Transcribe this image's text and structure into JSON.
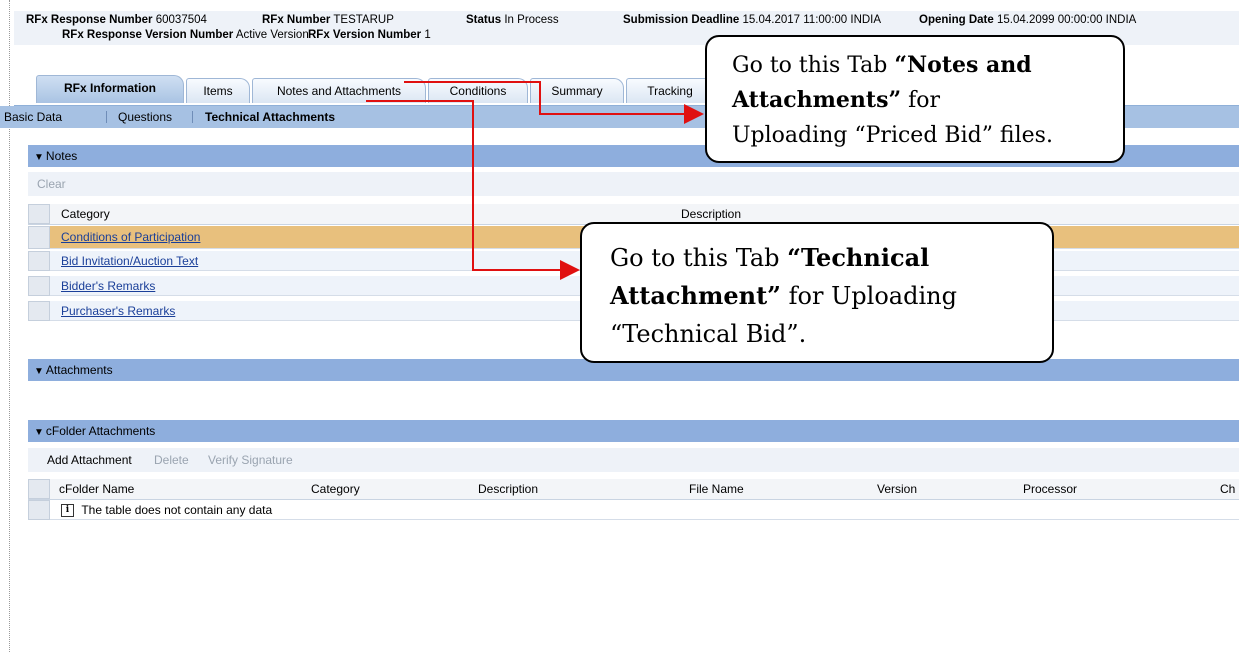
{
  "header": {
    "rfx_response_number_label": "RFx Response Number",
    "rfx_response_number": "60037504",
    "rfx_number_label": "RFx Number",
    "rfx_number": "TESTARUP",
    "status_label": "Status",
    "status": "In Process",
    "submission_deadline_label": "Submission Deadline",
    "submission_deadline": "15.04.2017 11:00:00 INDIA",
    "opening_date_label": "Opening Date",
    "opening_date": "15.04.2099 00:00:00 INDIA",
    "response_version_number_label": "RFx Response Version Number",
    "response_version_number": "Active Version",
    "rfx_version_number_label": "RFx Version Number",
    "rfx_version_number": "1"
  },
  "tabs": [
    "RFx Information",
    "Items",
    "Notes and Attachments",
    "Conditions",
    "Summary",
    "Tracking"
  ],
  "subnav": [
    "Basic Data",
    "Questions",
    "Technical Attachments"
  ],
  "notes": {
    "title": "Notes",
    "clear_label": "Clear",
    "col_category": "Category",
    "col_description": "Description",
    "rows": [
      "Conditions of Participation",
      "Bid Invitation/Auction Text",
      "Bidder's Remarks",
      "Purchaser's Remarks"
    ]
  },
  "attachments": {
    "title": "Attachments"
  },
  "cfolder": {
    "title": "cFolder Attachments",
    "add_label": "Add Attachment",
    "delete_label": "Delete",
    "verify_label": "Verify Signature",
    "columns": [
      "cFolder Name",
      "Category",
      "Description",
      "File Name",
      "Version",
      "Processor",
      "Ch"
    ],
    "empty_message": "The table does not contain any data"
  },
  "callouts": {
    "notes_tab": {
      "line1_pre": "Go to this Tab ",
      "line1_bold": "“Notes and",
      "line2_bold": "Attachments”",
      "line2_post": " for",
      "line3": "Uploading “Priced Bid” files."
    },
    "technical": {
      "line1_pre": "Go to this Tab ",
      "line1_bold": "“Technical",
      "line2_bold": "Attachment”",
      "line2_post": " for Uploading",
      "line3": "“Technical Bid”."
    }
  },
  "colors": {
    "arrow": "#e01010",
    "section_bar": "#8eaedd",
    "highlight_row": "#e8c07d",
    "link": "#1a3f99"
  }
}
